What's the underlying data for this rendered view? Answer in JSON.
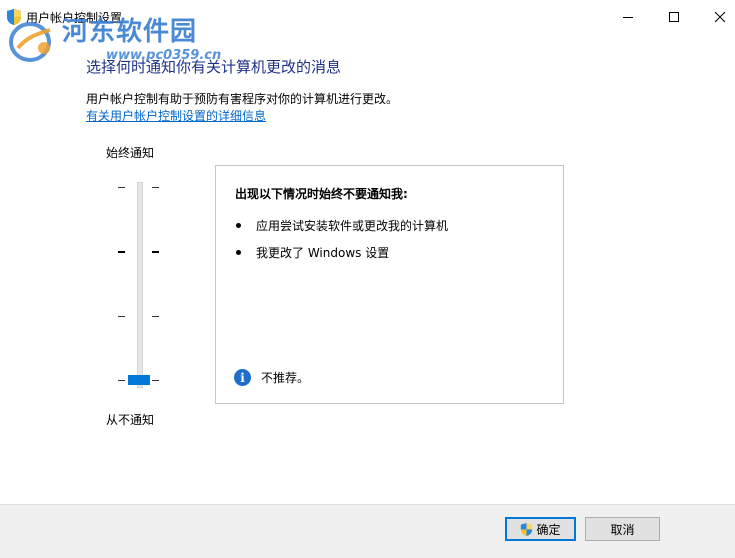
{
  "window": {
    "title": "用户帐户控制设置",
    "controls": {
      "minimize": "minimize-icon",
      "maximize": "maximize-icon",
      "close": "close-icon"
    }
  },
  "watermark": {
    "site_name": "河东软件园",
    "url": "www.pc0359.cn"
  },
  "main": {
    "heading": "选择何时通知你有关计算机更改的消息",
    "description": "用户帐户控制有助于预防有害程序对你的计算机进行更改。",
    "details_link": "有关用户帐户控制设置的详细信息"
  },
  "slider": {
    "top_label": "始终通知",
    "bottom_label": "从不通知",
    "levels": 4,
    "selected_level": 1,
    "accent_color": "#0078d7"
  },
  "panel": {
    "title": "出现以下情况时始终不要通知我:",
    "bullets": [
      "应用尝试安装软件或更改我的计算机",
      "我更改了 Windows 设置"
    ],
    "note": "不推荐。"
  },
  "buttons": {
    "ok": "确定",
    "cancel": "取消"
  },
  "colors": {
    "heading": "#1e3287",
    "link": "#0066cc",
    "info_icon": "#1f6ecc"
  }
}
